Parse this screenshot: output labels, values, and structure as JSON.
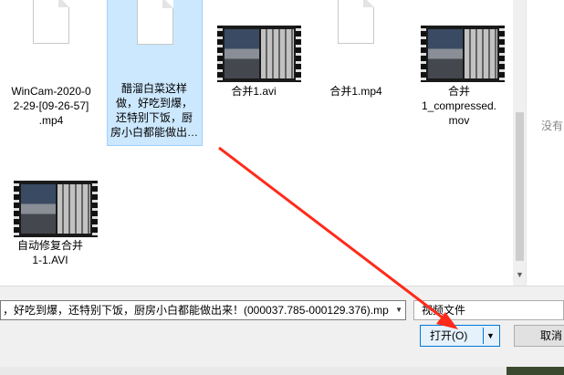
{
  "files": [
    {
      "name": "WinCam-2020-02-29-[09-26-57].mp4",
      "lines": [
        "WinCam-2020-0",
        "2-29-[09-26-57]",
        ".mp4"
      ],
      "kind": "document",
      "selected": false
    },
    {
      "name": "醋溜白菜这样做，好吃到爆，还特别下饭，厨房小白都能做出…",
      "lines": [
        "醋溜白菜这样",
        "做，好吃到爆，",
        "还特别下饭，厨",
        "房小白都能做出…"
      ],
      "kind": "document",
      "selected": true
    },
    {
      "name": "合并1.avi",
      "lines": [
        "合并1.avi"
      ],
      "kind": "video",
      "selected": false
    },
    {
      "name": "合并1.mp4",
      "lines": [
        "合并1.mp4"
      ],
      "kind": "document",
      "selected": false
    },
    {
      "name": "合并1_compressed.mov",
      "lines": [
        "合并",
        "1_compressed.",
        "mov"
      ],
      "kind": "video",
      "selected": false
    },
    {
      "name": "自动修复合并1-1.AVI",
      "lines": [
        "自动修复合并",
        "1-1.AVI"
      ],
      "kind": "video",
      "selected": false
    }
  ],
  "preview_hint": "没有",
  "filename_value": "，好吃到爆，还特别下饭，厨房小白都能做出来！(000037.785-000129.376).mp",
  "filetype_value": "视频文件",
  "open_label": "打开(O)",
  "cancel_label": "取消",
  "icons": {
    "dropdown": "chevron-down-icon",
    "scroll_down": "scroll-down-arrow-icon"
  },
  "colors": {
    "selection_bg": "#cce8ff",
    "primary_button_border": "#0078d7",
    "annotation_arrow": "#ff2a1a"
  }
}
